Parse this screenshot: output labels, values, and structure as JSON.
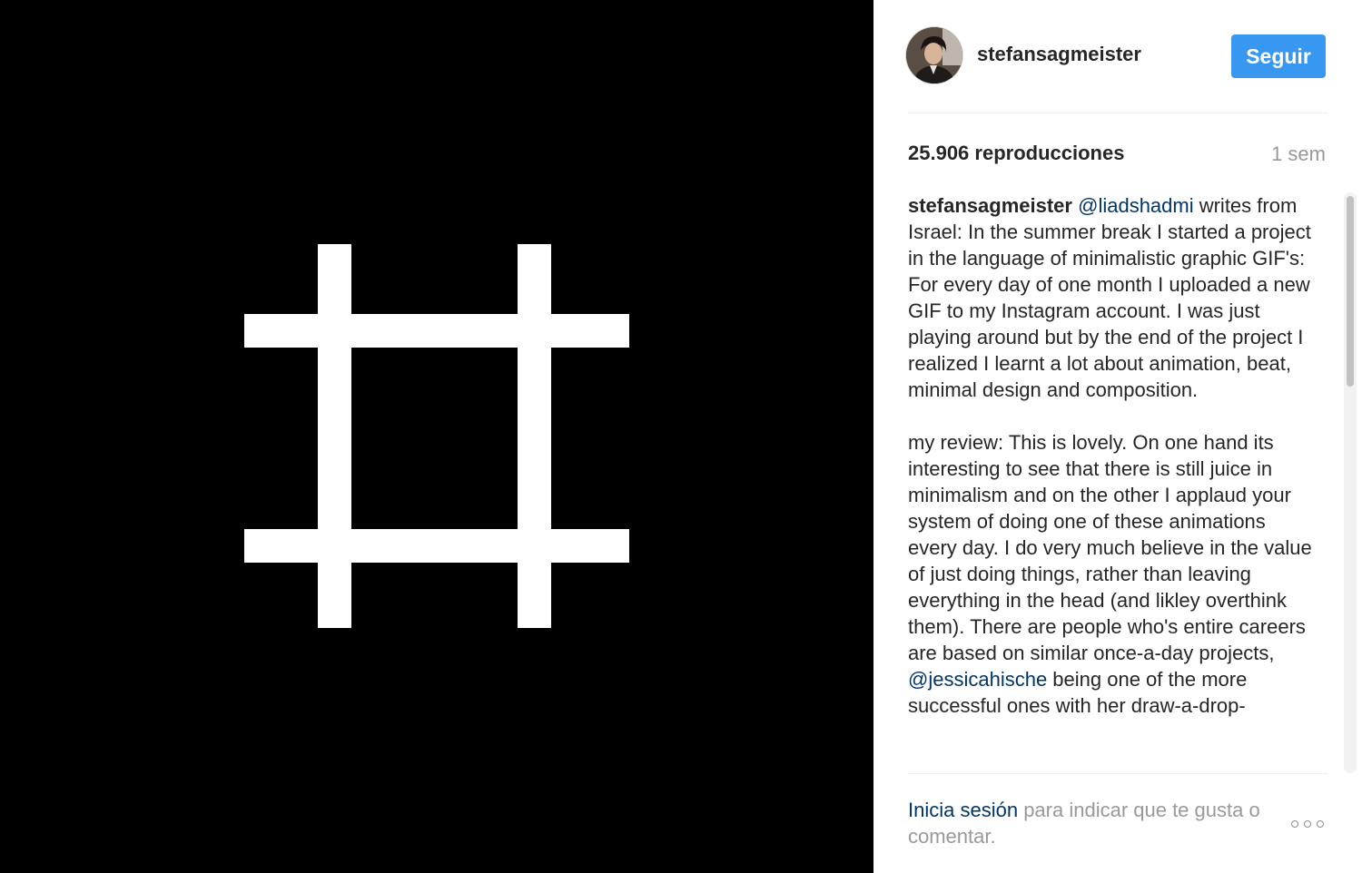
{
  "post": {
    "username": "stefansagmeister",
    "follow_label": "Seguir",
    "views": "25.906 reproducciones",
    "time": "1 sem",
    "avatar_icon": "profile-photo",
    "media_icon": "hash-grid-graphic"
  },
  "caption": {
    "author": "stefansagmeister",
    "mention1": "@liadshadmi",
    "text1": " writes from Israel: In the summer break I started a project in the language of minimalistic graphic GIF's: For every day of one month I uploaded a new GIF to my Instagram account. I was just playing around but by the end of the project I realized I learnt a lot about animation, beat, minimal design and composition.\n\nmy review: This is lovely. On one hand its interesting to see that there is still juice in minimalism and on the other I applaud your system of doing one of these animations every day. I do very much believe in the value of just doing things, rather than leaving everything in the head (and likley overthink them). There are people who's entire careers are based on similar once-a-day projects, ",
    "mention2": "@jessicahische",
    "text2": " being one of the more successful ones with her draw-a-drop-"
  },
  "footer": {
    "login_label": "Inicia sesión",
    "rest_text": " para indicar que te gusta o comentar.",
    "more_icon": "more-options-icon"
  },
  "colors": {
    "accent": "#3897f0",
    "link": "#003569",
    "muted": "#999999",
    "media_bg": "#000000"
  }
}
